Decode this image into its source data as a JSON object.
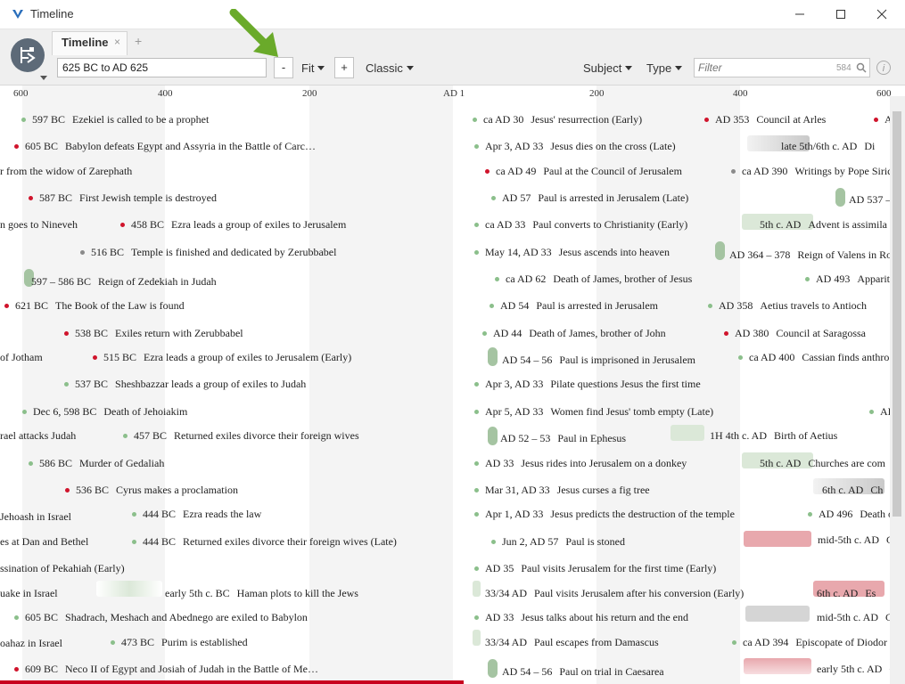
{
  "window": {
    "title": "Timeline",
    "minimize": "—",
    "maximize": "☐",
    "close": "✕"
  },
  "tabs": [
    {
      "label": "Timeline",
      "close": "×"
    }
  ],
  "tab_add": "+",
  "toolbar": {
    "range_value": "625 BC to AD 625",
    "zoom_out": "-",
    "zoom_mode": "Fit",
    "zoom_in": "+",
    "style": "Classic",
    "subject": "Subject",
    "type": "Type",
    "filter_placeholder": "Filter",
    "filter_count": "584",
    "info": "i"
  },
  "ruler": [
    "600",
    "400",
    "200",
    "AD 1",
    "200",
    "400",
    "600"
  ],
  "events": [
    {
      "d": "597 BC",
      "t": "Ezekiel is called to be a prophet",
      "c": "g"
    },
    {
      "d": "605 BC",
      "t": "Babylon defeats Egypt and Assyria in the Battle of Carc…",
      "c": "r"
    },
    {
      "d": "",
      "t": "r from the widow of Zarephath",
      "c": ""
    },
    {
      "d": "587 BC",
      "t": "First Jewish temple is destroyed",
      "c": "r"
    },
    {
      "d": "",
      "t": "n goes to Nineveh",
      "c": ""
    },
    {
      "d": "458 BC",
      "t": "Ezra leads a group of exiles to Jerusalem",
      "c": "r"
    },
    {
      "d": "516 BC",
      "t": "Temple is finished and dedicated by Zerubbabel",
      "c": "k"
    },
    {
      "d": "597 – 586 BC",
      "t": "Reign of Zedekiah in Judah",
      "c": ""
    },
    {
      "d": "621 BC",
      "t": "The Book of the Law is found",
      "c": "r"
    },
    {
      "d": "538 BC",
      "t": "Exiles return with Zerubbabel",
      "c": "r"
    },
    {
      "d": "",
      "t": "of Jotham",
      "c": ""
    },
    {
      "d": "515 BC",
      "t": "Ezra leads a group of exiles to Jerusalem (Early)",
      "c": "r"
    },
    {
      "d": "537 BC",
      "t": "Sheshbazzar leads a group of exiles to Judah",
      "c": "g"
    },
    {
      "d": "Dec 6, 598 BC",
      "t": "Death of Jehoiakim",
      "c": "g"
    },
    {
      "d": "",
      "t": "rael attacks Judah",
      "c": ""
    },
    {
      "d": "457 BC",
      "t": "Returned exiles divorce their foreign wives",
      "c": "g"
    },
    {
      "d": "586 BC",
      "t": "Murder of Gedaliah",
      "c": "g"
    },
    {
      "d": "536 BC",
      "t": "Cyrus makes a proclamation",
      "c": "r"
    },
    {
      "d": "",
      "t": "Jehoash in Israel",
      "c": ""
    },
    {
      "d": "444 BC",
      "t": "Ezra reads the law",
      "c": "g"
    },
    {
      "d": "",
      "t": "es at Dan and Bethel",
      "c": ""
    },
    {
      "d": "444 BC",
      "t": "Returned exiles divorce their foreign wives (Late)",
      "c": "g"
    },
    {
      "d": "",
      "t": "ssination of Pekahiah (Early)",
      "c": ""
    },
    {
      "d": "",
      "t": "uake in Israel",
      "c": ""
    },
    {
      "d": "early 5th c. BC",
      "t": "Haman plots to kill the Jews",
      "c": ""
    },
    {
      "d": "605 BC",
      "t": "Shadrach, Meshach and Abednego are exiled to Babylon",
      "c": "g"
    },
    {
      "d": "",
      "t": "oahaz in Israel",
      "c": ""
    },
    {
      "d": "473 BC",
      "t": "Purim is established",
      "c": "g"
    },
    {
      "d": "609 BC",
      "t": "Neco II of Egypt and Josiah of Judah in the Battle of Me…",
      "c": "r"
    },
    {
      "d": "ca AD 30",
      "t": "Jesus' resurrection (Early)",
      "c": "g"
    },
    {
      "d": "Apr 3, AD 33",
      "t": "Jesus dies on the cross (Late)",
      "c": "g"
    },
    {
      "d": "ca AD 49",
      "t": "Paul at the Council of Jerusalem",
      "c": "r"
    },
    {
      "d": "AD 57",
      "t": "Paul is arrested in Jerusalem (Late)",
      "c": "g"
    },
    {
      "d": "ca AD 33",
      "t": "Paul converts to Christianity (Early)",
      "c": "g"
    },
    {
      "d": "May 14, AD 33",
      "t": "Jesus ascends into heaven",
      "c": "g"
    },
    {
      "d": "ca AD 62",
      "t": "Death of James, brother of Jesus",
      "c": "g"
    },
    {
      "d": "AD 54",
      "t": "Paul is arrested in Jerusalem",
      "c": "g"
    },
    {
      "d": "AD 44",
      "t": "Death of James, brother of John",
      "c": "g"
    },
    {
      "d": "AD 54 – 56",
      "t": "Paul is imprisoned in Jerusalem",
      "c": ""
    },
    {
      "d": "Apr 3, AD 33",
      "t": "Pilate questions Jesus the first time",
      "c": "g"
    },
    {
      "d": "Apr 5, AD 33",
      "t": "Women find Jesus' tomb empty (Late)",
      "c": "g"
    },
    {
      "d": "AD 52 – 53",
      "t": "Paul in Ephesus",
      "c": ""
    },
    {
      "d": "AD 33",
      "t": "Jesus rides into Jerusalem on a donkey",
      "c": "g"
    },
    {
      "d": "Mar 31, AD 33",
      "t": "Jesus curses a fig tree",
      "c": "g"
    },
    {
      "d": "Apr 1, AD 33",
      "t": "Jesus predicts the destruction of the temple",
      "c": "g"
    },
    {
      "d": "Jun 2, AD 57",
      "t": "Paul is stoned",
      "c": "g"
    },
    {
      "d": "AD 35",
      "t": "Paul visits Jerusalem for the first time (Early)",
      "c": "g"
    },
    {
      "d": "33/34 AD",
      "t": "Paul visits Jerusalem after his conversion (Early)",
      "c": ""
    },
    {
      "d": "AD 33",
      "t": "Jesus talks about his return and the end",
      "c": "g"
    },
    {
      "d": "33/34 AD",
      "t": "Paul escapes from Damascus",
      "c": ""
    },
    {
      "d": "AD 54 – 56",
      "t": "Paul on trial in Caesarea",
      "c": ""
    },
    {
      "d": "AD 353",
      "t": "Council at Arles",
      "c": "r"
    },
    {
      "d": "late 5th/6th c. AD",
      "t": "Di",
      "c": ""
    },
    {
      "d": "ca AD 390",
      "t": "Writings by Pope Siric",
      "c": "k"
    },
    {
      "d": "AD 537 – 5",
      "t": "",
      "c": ""
    },
    {
      "d": "5th c. AD",
      "t": "Advent is assimila",
      "c": ""
    },
    {
      "d": "AD 364 – 378",
      "t": "Reign of Valens in Ro",
      "c": ""
    },
    {
      "d": "AD 493",
      "t": "Appariti",
      "c": "g"
    },
    {
      "d": "AD 358",
      "t": "Aetius travels to Antioch",
      "c": "g"
    },
    {
      "d": "AD 380",
      "t": "Council at Saragossa",
      "c": "r"
    },
    {
      "d": "ca AD 400",
      "t": "Cassian finds anthro",
      "c": "g"
    },
    {
      "d": "AD 5",
      "t": "",
      "c": "g"
    },
    {
      "d": "1H 4th c. AD",
      "t": "Birth of Aetius",
      "c": ""
    },
    {
      "d": "5th c. AD",
      "t": "Churches are com",
      "c": ""
    },
    {
      "d": "6th c. AD",
      "t": "Ch",
      "c": ""
    },
    {
      "d": "AD 496",
      "t": "Death of",
      "c": "g"
    },
    {
      "d": "mid-5th c. AD",
      "t": "Co",
      "c": ""
    },
    {
      "d": "6th c. AD",
      "t": "Es",
      "c": ""
    },
    {
      "d": "mid-5th c. AD",
      "t": "Co",
      "c": ""
    },
    {
      "d": "ca AD 394",
      "t": "Episcopate of Diodor",
      "c": "g"
    },
    {
      "d": "early 5th c. AD",
      "t": "Co",
      "c": ""
    },
    {
      "d": "",
      "t": "AD",
      "c": "r"
    }
  ]
}
